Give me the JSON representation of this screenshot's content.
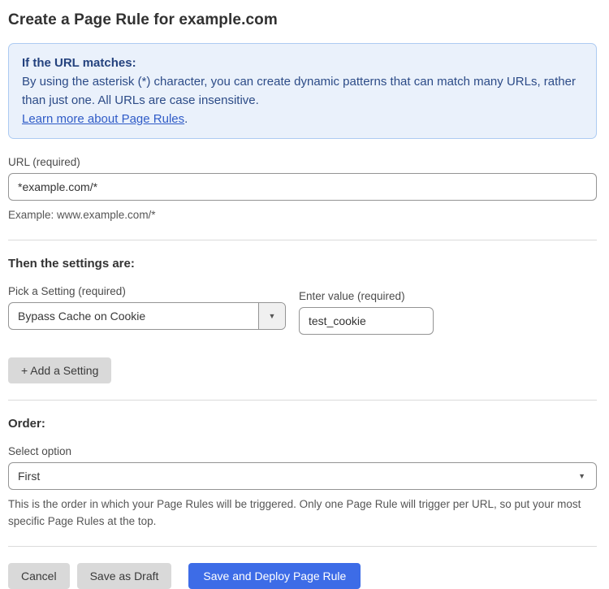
{
  "page": {
    "title": "Create a Page Rule for example.com"
  },
  "info_box": {
    "heading": "If the URL matches:",
    "body": "By using the asterisk (*) character, you can create dynamic patterns that can match many URLs, rather than just one. All URLs are case insensitive.",
    "link_text": "Learn more about Page Rules",
    "link_suffix": "."
  },
  "url_section": {
    "label": "URL (required)",
    "value": "*example.com/*",
    "helper": "Example: www.example.com/*"
  },
  "settings_section": {
    "heading": "Then the settings are:",
    "setting_label": "Pick a Setting (required)",
    "setting_selected": "Bypass Cache on Cookie",
    "value_label": "Enter value (required)",
    "value": "test_cookie",
    "add_button_label": "+ Add a Setting"
  },
  "order_section": {
    "heading": "Order:",
    "label": "Select option",
    "selected": "First",
    "helper": "This is the order in which your Page Rules will be triggered. Only one Page Rule will trigger per URL, so put your most specific Page Rules at the top."
  },
  "footer": {
    "cancel_label": "Cancel",
    "save_draft_label": "Save as Draft",
    "save_deploy_label": "Save and Deploy Page Rule"
  },
  "icons": {
    "dropdown_caret": "▼"
  },
  "colors": {
    "accent_blue": "#3D6CE7",
    "info_background": "#EAF1FB",
    "info_border": "#ADCBF2",
    "info_text": "#2C4B87",
    "link_blue": "#2F5BC7",
    "button_gray": "#D9D9D9",
    "input_border": "#949494",
    "divider": "#DBDBDB"
  }
}
